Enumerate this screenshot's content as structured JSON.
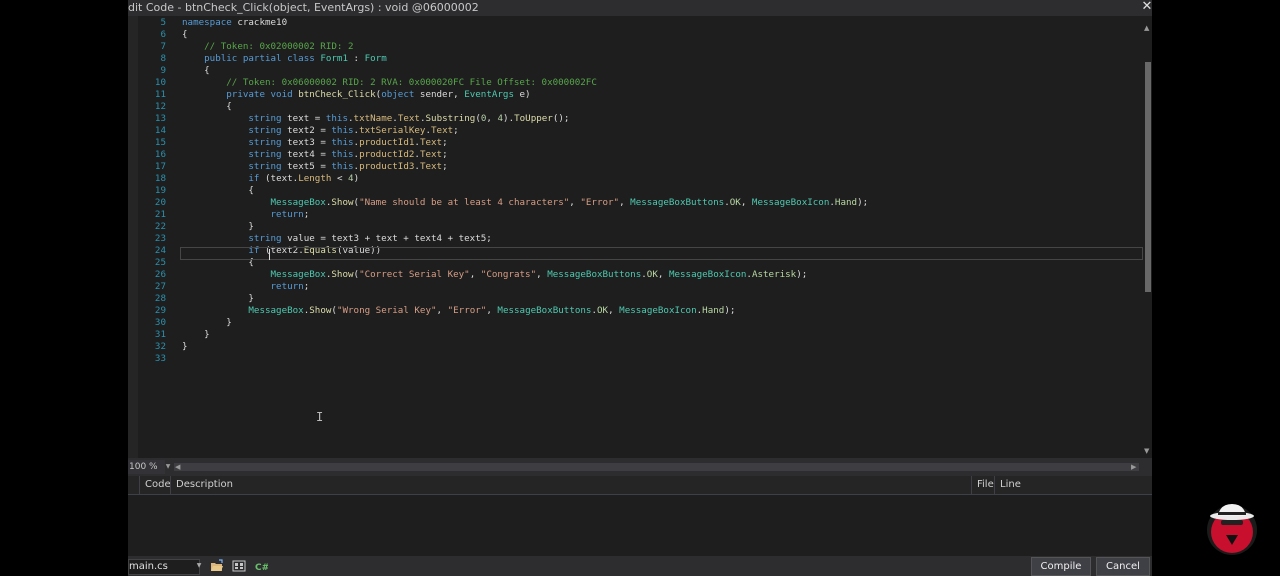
{
  "window": {
    "title": "dit Code - btnCheck_Click(object, EventArgs) : void @06000002",
    "close_symbol": "✕"
  },
  "editor": {
    "zoom": "100 %",
    "lines": [
      {
        "n": "5",
        "segs": [
          [
            "kw",
            "namespace "
          ],
          [
            "",
            "crackme10"
          ]
        ]
      },
      {
        "n": "6",
        "segs": [
          [
            "",
            "{"
          ]
        ]
      },
      {
        "n": "7",
        "segs": [
          [
            "",
            "    "
          ],
          [
            "cmt",
            "// Token: 0x02000002 RID: 2"
          ]
        ]
      },
      {
        "n": "8",
        "segs": [
          [
            "",
            "    "
          ],
          [
            "kw",
            "public partial class "
          ],
          [
            "typ",
            "Form1"
          ],
          [
            "",
            " : "
          ],
          [
            "typ",
            "Form"
          ]
        ]
      },
      {
        "n": "9",
        "segs": [
          [
            "",
            "    {"
          ]
        ]
      },
      {
        "n": "10",
        "segs": [
          [
            "",
            "        "
          ],
          [
            "cmt",
            "// Token: 0x06000002 RID: 2 RVA: 0x000020FC File Offset: 0x000002FC"
          ]
        ]
      },
      {
        "n": "11",
        "segs": [
          [
            "",
            "        "
          ],
          [
            "kw",
            "private void "
          ],
          [
            "mth",
            "btnCheck_Click"
          ],
          [
            "",
            "("
          ],
          [
            "kw",
            "object "
          ],
          [
            "",
            "sender, "
          ],
          [
            "typ",
            "EventArgs"
          ],
          [
            "",
            " e)"
          ]
        ]
      },
      {
        "n": "12",
        "segs": [
          [
            "",
            "        {"
          ]
        ]
      },
      {
        "n": "13",
        "segs": [
          [
            "",
            "            "
          ],
          [
            "kw",
            "string "
          ],
          [
            "",
            "text = "
          ],
          [
            "kw",
            "this"
          ],
          [
            "",
            "."
          ],
          [
            "prop",
            "txtName"
          ],
          [
            "",
            "."
          ],
          [
            "prop",
            "Text"
          ],
          [
            "",
            "."
          ],
          [
            "mth",
            "Substring"
          ],
          [
            "",
            "("
          ],
          [
            "num",
            "0"
          ],
          [
            ", "
          ],
          [
            "num",
            "4"
          ],
          [
            ")."
          ],
          [
            "mth",
            "ToUpper"
          ],
          [
            "();"
          ]
        ]
      },
      {
        "n": "14",
        "segs": [
          [
            "",
            "            "
          ],
          [
            "kw",
            "string "
          ],
          [
            "",
            "text2 = "
          ],
          [
            "kw",
            "this"
          ],
          [
            "",
            "."
          ],
          [
            "prop",
            "txtSerialKey"
          ],
          [
            "",
            "."
          ],
          [
            "prop",
            "Text"
          ],
          [
            ";"
          ]
        ]
      },
      {
        "n": "15",
        "segs": [
          [
            "",
            "            "
          ],
          [
            "kw",
            "string "
          ],
          [
            "",
            "text3 = "
          ],
          [
            "kw",
            "this"
          ],
          [
            "",
            "."
          ],
          [
            "prop",
            "productId1"
          ],
          [
            "",
            "."
          ],
          [
            "prop",
            "Text"
          ],
          [
            ";"
          ]
        ]
      },
      {
        "n": "16",
        "segs": [
          [
            "",
            "            "
          ],
          [
            "kw",
            "string "
          ],
          [
            "",
            "text4 = "
          ],
          [
            "kw",
            "this"
          ],
          [
            "",
            "."
          ],
          [
            "prop",
            "productId2"
          ],
          [
            "",
            "."
          ],
          [
            "prop",
            "Text"
          ],
          [
            ";"
          ]
        ]
      },
      {
        "n": "17",
        "segs": [
          [
            "",
            "            "
          ],
          [
            "kw",
            "string "
          ],
          [
            "",
            "text5 = "
          ],
          [
            "kw",
            "this"
          ],
          [
            "",
            "."
          ],
          [
            "prop",
            "productId3"
          ],
          [
            "",
            "."
          ],
          [
            "prop",
            "Text"
          ],
          [
            ";"
          ]
        ]
      },
      {
        "n": "18",
        "segs": [
          [
            "",
            "            "
          ],
          [
            "kw",
            "if "
          ],
          [
            "",
            "(text."
          ],
          [
            "prop",
            "Length"
          ],
          [
            "",
            " < "
          ],
          [
            "num",
            "4"
          ],
          [
            ")"
          ]
        ]
      },
      {
        "n": "19",
        "segs": [
          [
            "",
            "            {"
          ]
        ]
      },
      {
        "n": "20",
        "segs": [
          [
            "",
            "                "
          ],
          [
            "typ",
            "MessageBox"
          ],
          [
            "",
            "."
          ],
          [
            "mth",
            "Show"
          ],
          [
            "",
            "("
          ],
          [
            "str",
            "\"Name should be at least 4 characters\""
          ],
          [
            ", "
          ],
          [
            "str",
            "\"Error\""
          ],
          [
            ", "
          ],
          [
            "typ",
            "MessageBoxButtons"
          ],
          [
            "",
            "."
          ],
          [
            "en",
            "OK"
          ],
          [
            ", "
          ],
          [
            "typ",
            "MessageBoxIcon"
          ],
          [
            "",
            "."
          ],
          [
            "en",
            "Hand"
          ],
          [
            ");"
          ]
        ]
      },
      {
        "n": "21",
        "segs": [
          [
            "",
            "                "
          ],
          [
            "kw",
            "return"
          ],
          [
            ";"
          ]
        ]
      },
      {
        "n": "22",
        "segs": [
          [
            "",
            "            }"
          ]
        ]
      },
      {
        "n": "23",
        "segs": [
          [
            "",
            "            "
          ],
          [
            "kw",
            "string "
          ],
          [
            "",
            "value = text3 + text + text4 + text5;"
          ]
        ]
      },
      {
        "n": "24",
        "segs": [
          [
            "",
            "            "
          ],
          [
            "kw",
            "if "
          ],
          [
            "",
            "(text2."
          ],
          [
            "mth",
            "Equals"
          ],
          [
            "",
            "(value))"
          ]
        ]
      },
      {
        "n": "25",
        "segs": [
          [
            "",
            "            {"
          ]
        ]
      },
      {
        "n": "26",
        "segs": [
          [
            "",
            "                "
          ],
          [
            "typ",
            "MessageBox"
          ],
          [
            "",
            "."
          ],
          [
            "mth",
            "Show"
          ],
          [
            "",
            "("
          ],
          [
            "str",
            "\"Correct Serial Key\""
          ],
          [
            ", "
          ],
          [
            "str",
            "\"Congrats\""
          ],
          [
            ", "
          ],
          [
            "typ",
            "MessageBoxButtons"
          ],
          [
            "",
            "."
          ],
          [
            "en",
            "OK"
          ],
          [
            ", "
          ],
          [
            "typ",
            "MessageBoxIcon"
          ],
          [
            "",
            "."
          ],
          [
            "en",
            "Asterisk"
          ],
          [
            ");"
          ]
        ]
      },
      {
        "n": "27",
        "segs": [
          [
            "",
            "                "
          ],
          [
            "kw",
            "return"
          ],
          [
            ";"
          ]
        ]
      },
      {
        "n": "28",
        "segs": [
          [
            "",
            "            }"
          ]
        ]
      },
      {
        "n": "29",
        "segs": [
          [
            "",
            "            "
          ],
          [
            "typ",
            "MessageBox"
          ],
          [
            "",
            "."
          ],
          [
            "mth",
            "Show"
          ],
          [
            "",
            "("
          ],
          [
            "str",
            "\"Wrong Serial Key\""
          ],
          [
            ", "
          ],
          [
            "str",
            "\"Error\""
          ],
          [
            ", "
          ],
          [
            "typ",
            "MessageBoxButtons"
          ],
          [
            "",
            "."
          ],
          [
            "en",
            "OK"
          ],
          [
            ", "
          ],
          [
            "typ",
            "MessageBoxIcon"
          ],
          [
            "",
            "."
          ],
          [
            "en",
            "Hand"
          ],
          [
            ");"
          ]
        ]
      },
      {
        "n": "30",
        "segs": [
          [
            "",
            "        }"
          ]
        ]
      },
      {
        "n": "31",
        "segs": [
          [
            "",
            "    }"
          ]
        ]
      },
      {
        "n": "32",
        "segs": [
          [
            "",
            "}"
          ]
        ]
      },
      {
        "n": "33",
        "segs": []
      }
    ]
  },
  "errors": {
    "columns": {
      "code": "Code",
      "description": "Description",
      "file": "File",
      "line": "Line"
    }
  },
  "bottom": {
    "file": "main.cs",
    "compile": "Compile",
    "cancel": "Cancel"
  },
  "colors": {
    "keyword": "#569cd6",
    "type": "#4ec9b0",
    "string": "#d69d85",
    "comment": "#57a64a",
    "line_number": "#2b91af",
    "background": "#1e1e1e"
  },
  "icons": {
    "open": "folder-open-icon",
    "refs": "assembly-refs-icon",
    "csharp": "csharp-icon",
    "badge": "hat-mascot-logo"
  }
}
